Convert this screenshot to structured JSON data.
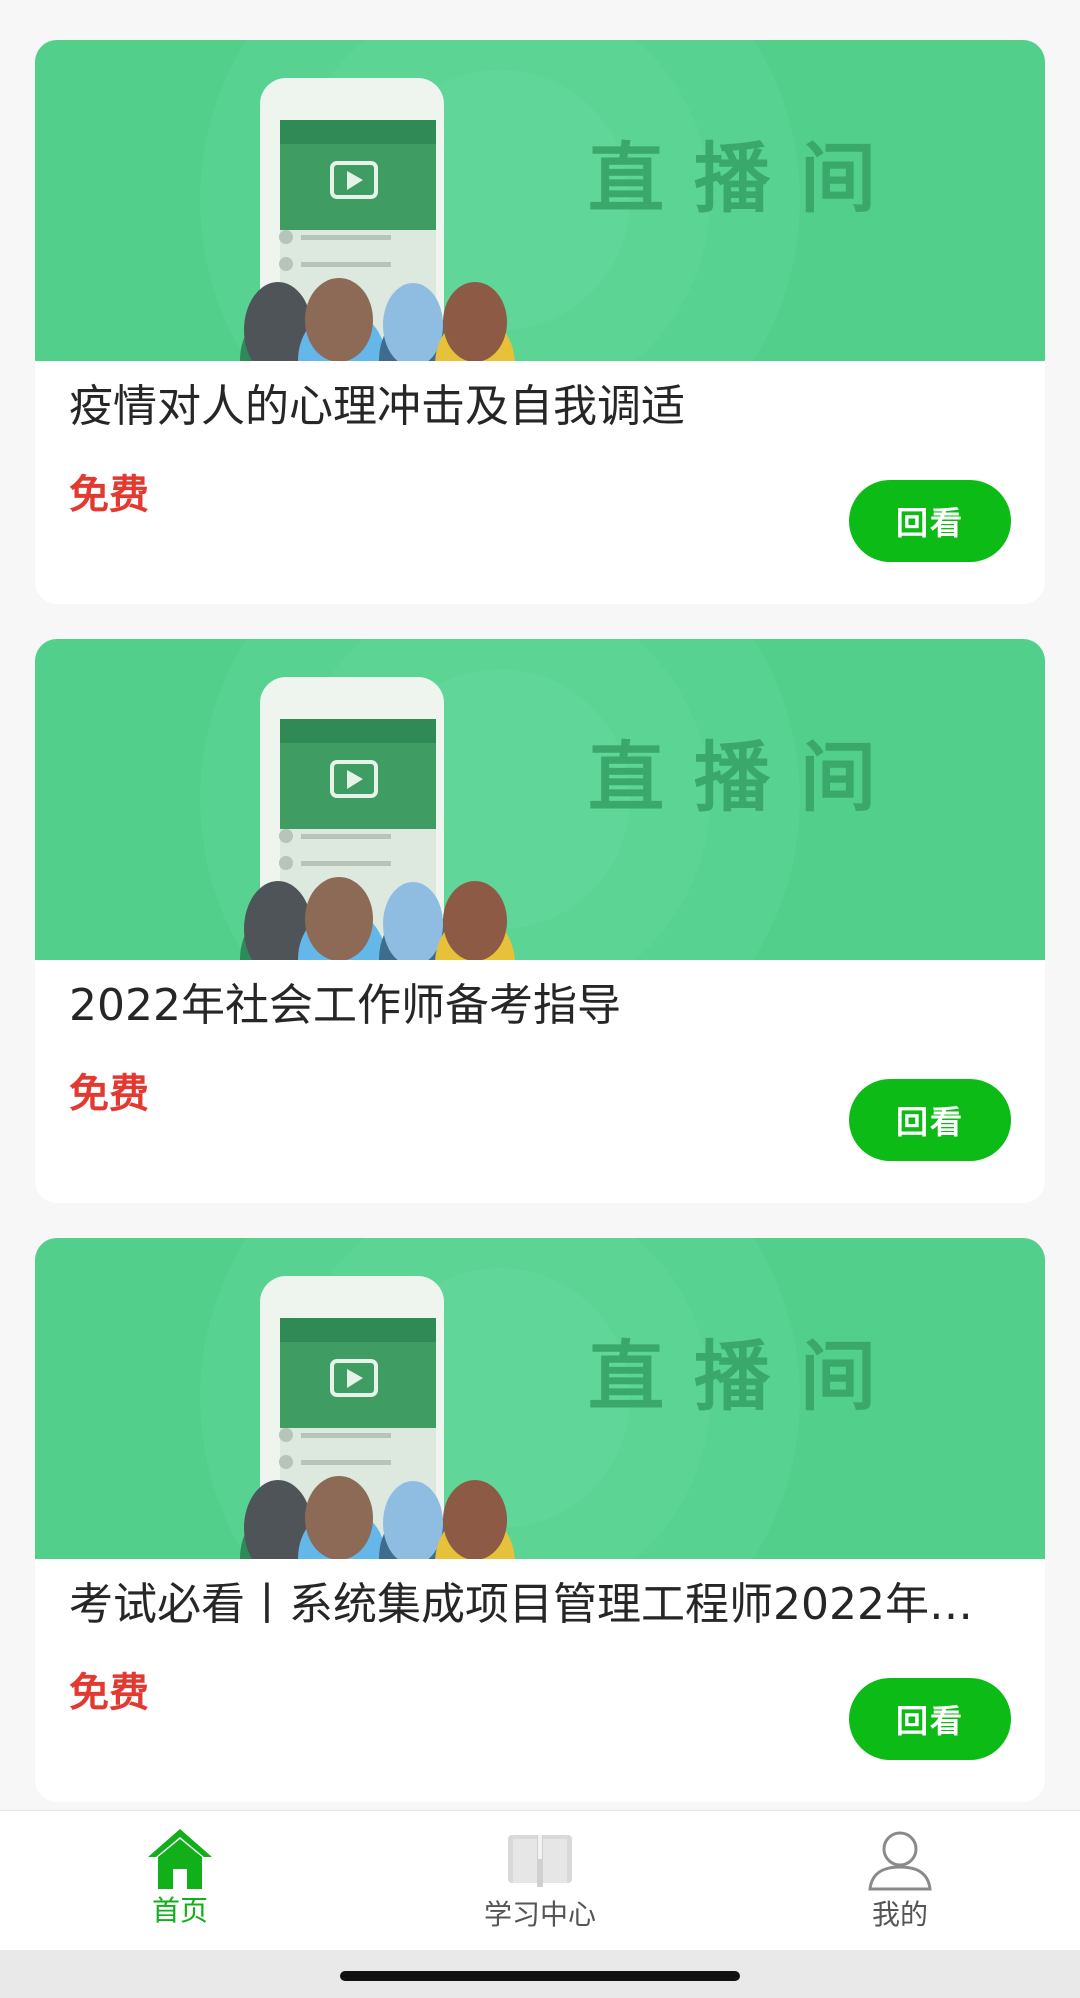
{
  "courses": [
    {
      "banner_text": "直播间",
      "title": "疫情对人的心理冲击及自我调适",
      "price": "免费",
      "button": "回看"
    },
    {
      "banner_text": "直播间",
      "title": "2022年社会工作师备考指导",
      "price": "免费",
      "button": "回看"
    },
    {
      "banner_text": "直播间",
      "title": "考试必看丨系统集成项目管理工程师2022年…",
      "price": "免费",
      "button": "回看"
    }
  ],
  "tabbar": {
    "items": [
      {
        "label": "首页",
        "icon": "home-icon",
        "active": true
      },
      {
        "label": "学习中心",
        "icon": "book-icon",
        "active": false
      },
      {
        "label": "我的",
        "icon": "user-icon",
        "active": false
      }
    ]
  },
  "colors": {
    "accent": "#0dbb16",
    "price": "#e23a30",
    "banner": "#52cf8a"
  }
}
